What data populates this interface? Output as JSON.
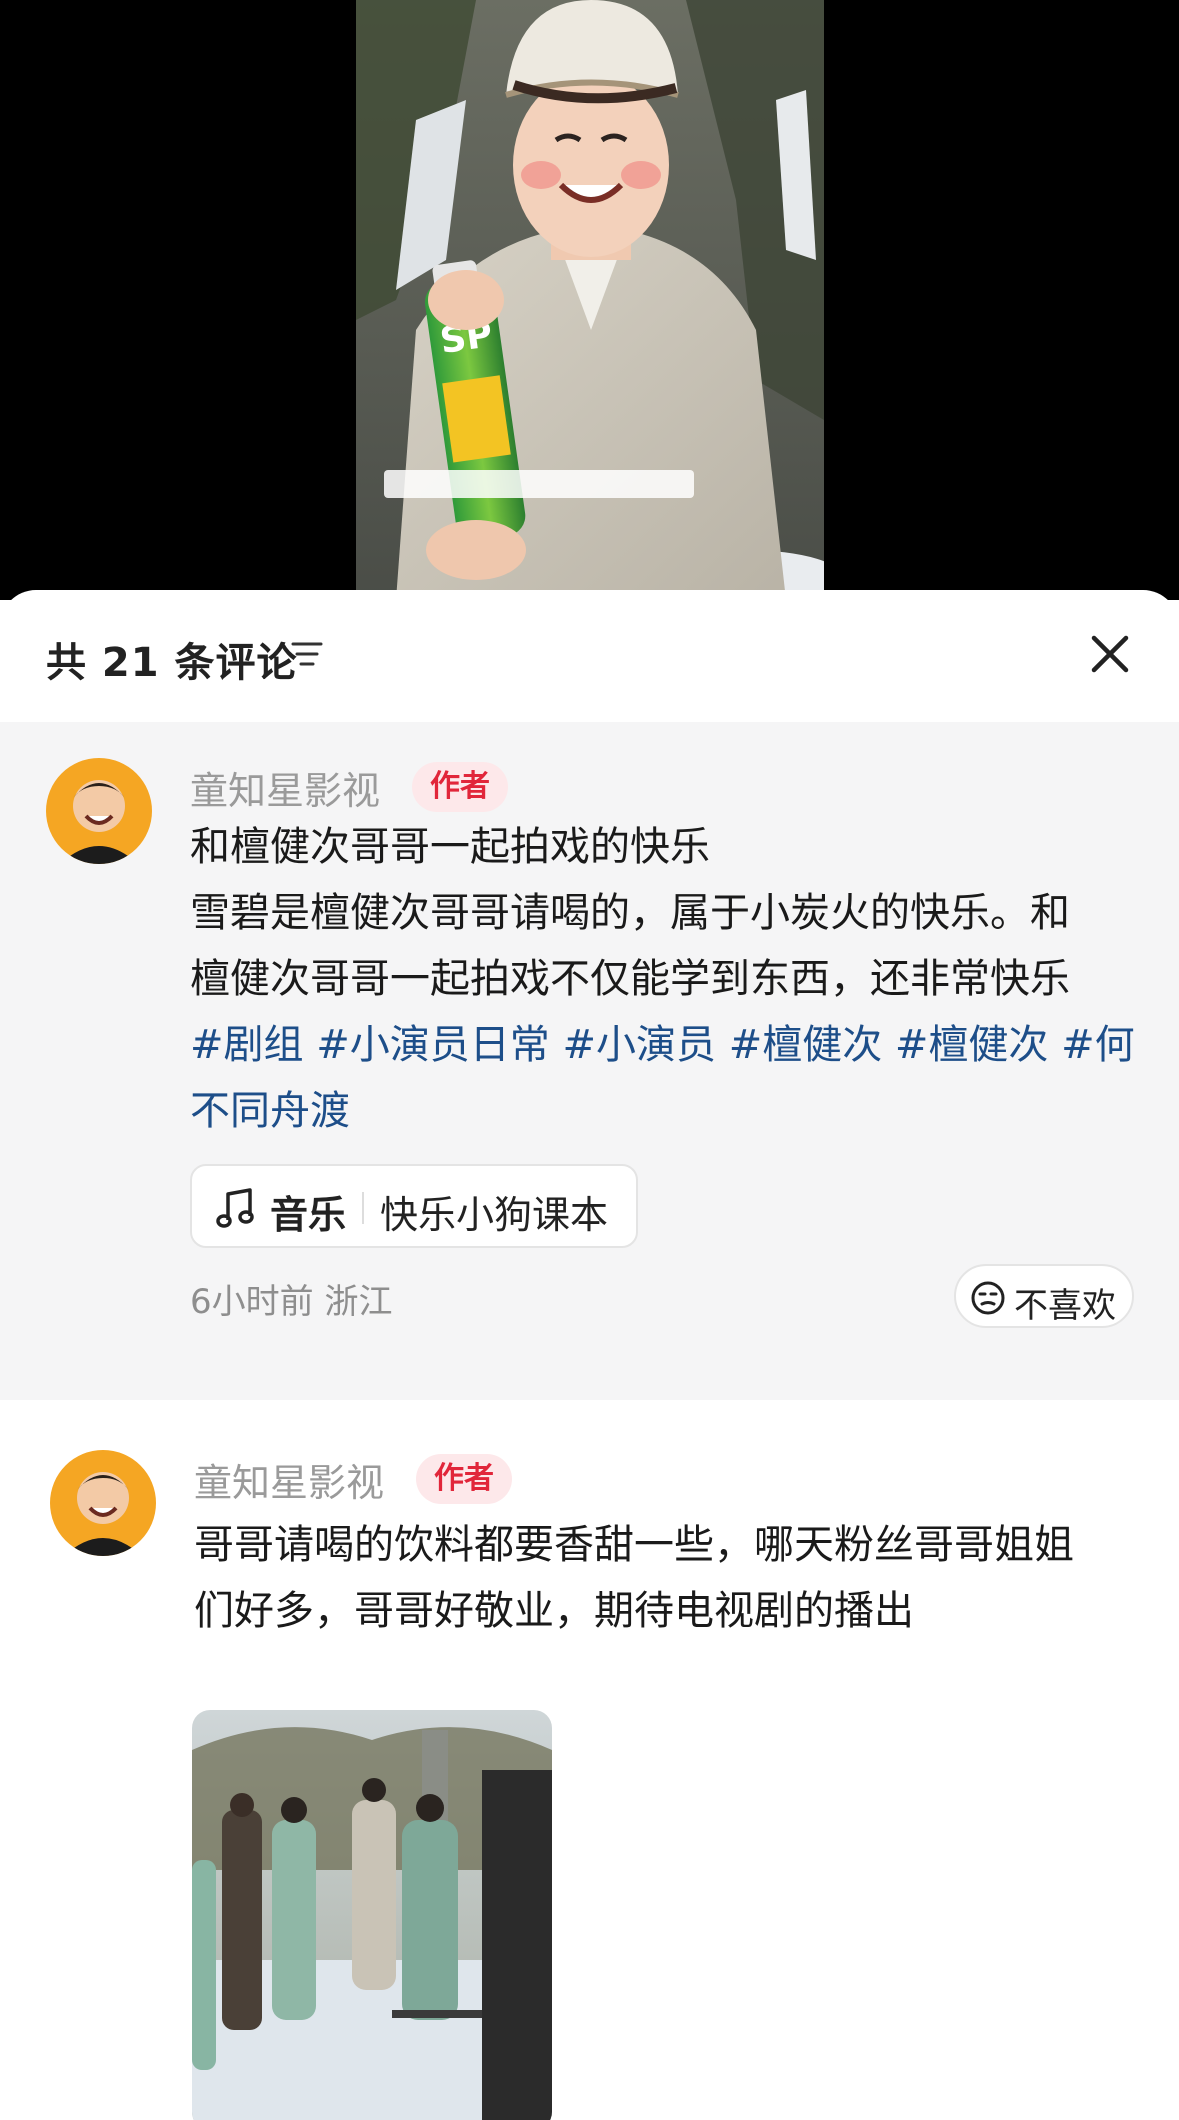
{
  "comments_panel": {
    "count_label": "共 21 条评论",
    "sort_icon": "sort-filter-icon",
    "close_icon": "close-icon"
  },
  "comments": [
    {
      "username": "童知星影视",
      "badge": "作者",
      "text_lines": [
        "和檀健次哥哥一起拍戏的快乐",
        "雪碧是檀健次哥哥请喝的，属于小炭火的快乐。和",
        "檀健次哥哥一起拍戏不仅能学到东西，还非常快乐",
        "#剧组 #小演员日常 #小演员 #檀健次 #檀健次 #何",
        "不同舟渡"
      ],
      "music": {
        "icon": "music-note-icon",
        "label": "音乐",
        "title": "快乐小狗课本"
      },
      "meta": "6小时前  浙江",
      "dislike_label": "不喜欢",
      "dislike_icon": "face-neutral-icon"
    },
    {
      "username": "童知星影视",
      "badge": "作者",
      "text_lines": [
        "哥哥请喝的饮料都要香甜一些，哪天粉丝哥哥姐姐",
        "们好多，哥哥好敬业，期待电视剧的播出"
      ]
    }
  ],
  "colors": {
    "badge_bg": "#fde8ea",
    "badge_text": "#e1263a",
    "hashtag": "#1d4e89",
    "highlight_bg": "#f5f5f6"
  }
}
